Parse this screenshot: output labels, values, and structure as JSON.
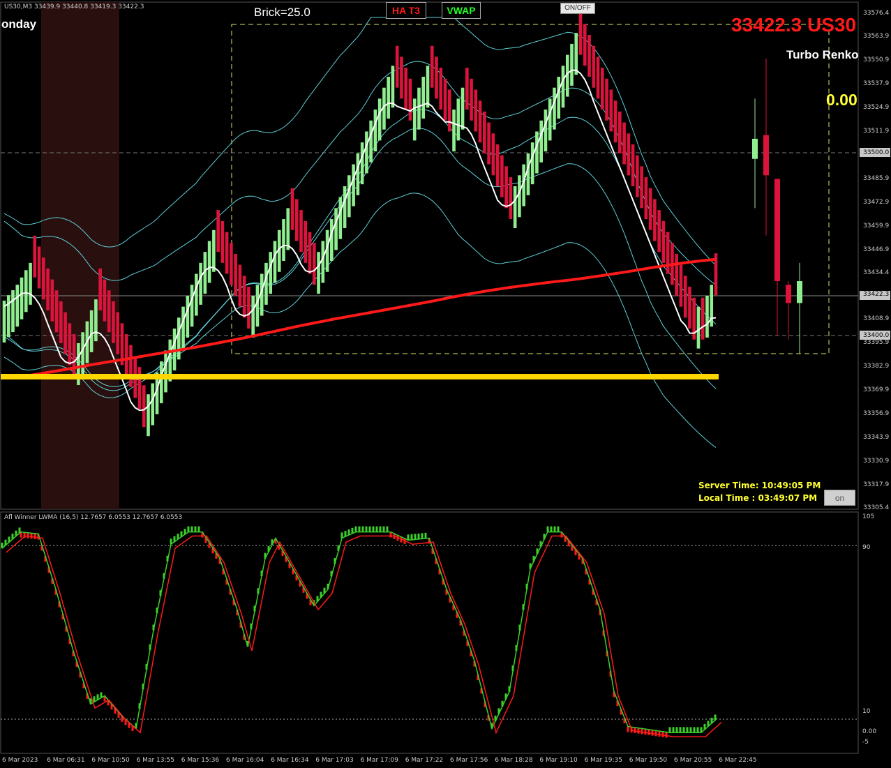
{
  "symbol_info": "US30,M3  33439.9 33440.8 33419.3 33422.3",
  "day_label": "onday",
  "brick_label": "Brick=25.0",
  "buttons": {
    "ha_t3": "HA T3",
    "vwap": "VWAP",
    "on_off": "ON/OFF",
    "on": "on"
  },
  "price_display": "33422.3 US30",
  "chart_type_label": "Turbo Renko",
  "value_display": "0.00",
  "server_time": "Server Time: 10:49:05 PM",
  "local_time": "Local Time  : 03:49:07 PM",
  "indicator_label": "Afl Winner LWMA (16,5) 12.7657 6.0553 12.7657 6.0553",
  "price_axis": [
    "33576.4",
    "33563.9",
    "33550.9",
    "33537.9",
    "33524.9",
    "33511.9",
    "33500.0",
    "33485.9",
    "33472.9",
    "33459.9",
    "33446.9",
    "33434.4",
    "33422.3",
    "33408.9",
    "33400.0",
    "33395.9",
    "33382.9",
    "33369.9",
    "33356.9",
    "33343.9",
    "33330.9",
    "33317.9",
    "33305.4"
  ],
  "indicator_axis": [
    "105",
    "90",
    "10",
    "0.00",
    "-5"
  ],
  "time_axis": [
    "6 Mar 2023",
    "6 Mar 06:31",
    "6 Mar 10:50",
    "6 Mar 13:55",
    "6 Mar 15:36",
    "6 Mar 16:04",
    "6 Mar 16:34",
    "6 Mar 17:03",
    "6 Mar 17:09",
    "6 Mar 17:22",
    "6 Mar 17:56",
    "6 Mar 18:28",
    "6 Mar 19:10",
    "6 Mar 19:35",
    "6 Mar 19:50",
    "6 Mar 20:55",
    "6 Mar 22:45"
  ],
  "colors": {
    "bull": "#90ee90",
    "bear": "#dc143c",
    "band": "#5fcfd8",
    "red_line": "#ff1a1a",
    "yellow_line": "#ffd700",
    "osc_green": "#3ccf2a",
    "osc_red": "#ff1a1a"
  },
  "chart_data": {
    "type": "candlestick",
    "bricks": [
      {
        "p": 33419.3,
        "d": 1
      },
      {
        "p": 33422.3,
        "d": 1
      },
      {
        "p": 33425,
        "d": 1
      },
      {
        "p": 33428,
        "d": 1
      },
      {
        "p": 33432,
        "d": 1
      },
      {
        "p": 33436,
        "d": 1
      },
      {
        "p": 33440,
        "d": 1
      },
      {
        "p": 33432,
        "d": -1
      },
      {
        "p": 33426,
        "d": -1
      },
      {
        "p": 33420,
        "d": -1
      },
      {
        "p": 33414,
        "d": -1
      },
      {
        "p": 33408,
        "d": -1
      },
      {
        "p": 33402,
        "d": -1
      },
      {
        "p": 33396,
        "d": -1
      },
      {
        "p": 33390,
        "d": -1
      },
      {
        "p": 33384,
        "d": -1
      },
      {
        "p": 33378,
        "d": -1
      },
      {
        "p": 33396,
        "d": 1
      },
      {
        "p": 33402,
        "d": 1
      },
      {
        "p": 33408,
        "d": 1
      },
      {
        "p": 33414,
        "d": 1
      },
      {
        "p": 33420,
        "d": 1
      },
      {
        "p": 33414,
        "d": -1
      },
      {
        "p": 33408,
        "d": -1
      },
      {
        "p": 33402,
        "d": -1
      },
      {
        "p": 33396,
        "d": -1
      },
      {
        "p": 33390,
        "d": -1
      },
      {
        "p": 33384,
        "d": -1
      },
      {
        "p": 33378,
        "d": -1
      },
      {
        "p": 33372,
        "d": -1
      },
      {
        "p": 33366,
        "d": -1
      },
      {
        "p": 33360,
        "d": -1
      },
      {
        "p": 33350,
        "d": -1
      },
      {
        "p": 33368,
        "d": 1
      },
      {
        "p": 33374,
        "d": 1
      },
      {
        "p": 33380,
        "d": 1
      },
      {
        "p": 33386,
        "d": 1
      },
      {
        "p": 33392,
        "d": 1
      },
      {
        "p": 33398,
        "d": 1
      },
      {
        "p": 33404,
        "d": 1
      },
      {
        "p": 33410,
        "d": 1
      },
      {
        "p": 33416,
        "d": 1
      },
      {
        "p": 33422,
        "d": 1
      },
      {
        "p": 33428,
        "d": 1
      },
      {
        "p": 33434,
        "d": 1
      },
      {
        "p": 33440,
        "d": 1
      },
      {
        "p": 33446,
        "d": 1
      },
      {
        "p": 33452,
        "d": 1
      },
      {
        "p": 33458,
        "d": 1
      },
      {
        "p": 33446,
        "d": -1
      },
      {
        "p": 33440,
        "d": -1
      },
      {
        "p": 33434,
        "d": -1
      },
      {
        "p": 33428,
        "d": -1
      },
      {
        "p": 33422,
        "d": -1
      },
      {
        "p": 33416,
        "d": -1
      },
      {
        "p": 33410,
        "d": -1
      },
      {
        "p": 33404,
        "d": -1
      },
      {
        "p": 33422,
        "d": 1
      },
      {
        "p": 33428,
        "d": 1
      },
      {
        "p": 33434,
        "d": 1
      },
      {
        "p": 33440,
        "d": 1
      },
      {
        "p": 33446,
        "d": 1
      },
      {
        "p": 33452,
        "d": 1
      },
      {
        "p": 33458,
        "d": 1
      },
      {
        "p": 33464,
        "d": 1
      },
      {
        "p": 33470,
        "d": 1
      },
      {
        "p": 33458,
        "d": -1
      },
      {
        "p": 33452,
        "d": -1
      },
      {
        "p": 33446,
        "d": -1
      },
      {
        "p": 33440,
        "d": -1
      },
      {
        "p": 33434,
        "d": -1
      },
      {
        "p": 33428,
        "d": -1
      },
      {
        "p": 33446,
        "d": 1
      },
      {
        "p": 33452,
        "d": 1
      },
      {
        "p": 33458,
        "d": 1
      },
      {
        "p": 33464,
        "d": 1
      },
      {
        "p": 33470,
        "d": 1
      },
      {
        "p": 33476,
        "d": 1
      },
      {
        "p": 33482,
        "d": 1
      },
      {
        "p": 33488,
        "d": 1
      },
      {
        "p": 33494,
        "d": 1
      },
      {
        "p": 33500,
        "d": 1
      },
      {
        "p": 33506,
        "d": 1
      },
      {
        "p": 33512,
        "d": 1
      },
      {
        "p": 33518,
        "d": 1
      },
      {
        "p": 33524,
        "d": 1
      },
      {
        "p": 33530,
        "d": 1
      },
      {
        "p": 33536,
        "d": 1
      },
      {
        "p": 33542,
        "d": 1
      },
      {
        "p": 33548,
        "d": 1
      },
      {
        "p": 33536,
        "d": -1
      },
      {
        "p": 33530,
        "d": -1
      },
      {
        "p": 33524,
        "d": -1
      },
      {
        "p": 33518,
        "d": -1
      },
      {
        "p": 33530,
        "d": 1
      },
      {
        "p": 33536,
        "d": 1
      },
      {
        "p": 33542,
        "d": 1
      },
      {
        "p": 33548,
        "d": 1
      },
      {
        "p": 33536,
        "d": -1
      },
      {
        "p": 33530,
        "d": -1
      },
      {
        "p": 33524,
        "d": -1
      },
      {
        "p": 33518,
        "d": -1
      },
      {
        "p": 33512,
        "d": -1
      },
      {
        "p": 33524,
        "d": 1
      },
      {
        "p": 33530,
        "d": 1
      },
      {
        "p": 33536,
        "d": 1
      },
      {
        "p": 33524,
        "d": -1
      },
      {
        "p": 33518,
        "d": -1
      },
      {
        "p": 33512,
        "d": -1
      },
      {
        "p": 33506,
        "d": -1
      },
      {
        "p": 33500,
        "d": -1
      },
      {
        "p": 33494,
        "d": -1
      },
      {
        "p": 33488,
        "d": -1
      },
      {
        "p": 33482,
        "d": -1
      },
      {
        "p": 33476,
        "d": -1
      },
      {
        "p": 33470,
        "d": -1
      },
      {
        "p": 33464,
        "d": -1
      },
      {
        "p": 33482,
        "d": 1
      },
      {
        "p": 33488,
        "d": 1
      },
      {
        "p": 33494,
        "d": 1
      },
      {
        "p": 33500,
        "d": 1
      },
      {
        "p": 33506,
        "d": 1
      },
      {
        "p": 33512,
        "d": 1
      },
      {
        "p": 33518,
        "d": 1
      },
      {
        "p": 33524,
        "d": 1
      },
      {
        "p": 33530,
        "d": 1
      },
      {
        "p": 33536,
        "d": 1
      },
      {
        "p": 33542,
        "d": 1
      },
      {
        "p": 33548,
        "d": 1
      },
      {
        "p": 33554,
        "d": 1
      },
      {
        "p": 33560,
        "d": 1
      },
      {
        "p": 33566,
        "d": 1
      },
      {
        "p": 33554,
        "d": -1
      },
      {
        "p": 33548,
        "d": -1
      },
      {
        "p": 33542,
        "d": -1
      },
      {
        "p": 33536,
        "d": -1
      },
      {
        "p": 33530,
        "d": -1
      },
      {
        "p": 33524,
        "d": -1
      },
      {
        "p": 33518,
        "d": -1
      },
      {
        "p": 33512,
        "d": -1
      },
      {
        "p": 33506,
        "d": -1
      },
      {
        "p": 33500,
        "d": -1
      },
      {
        "p": 33494,
        "d": -1
      },
      {
        "p": 33488,
        "d": -1
      },
      {
        "p": 33482,
        "d": -1
      },
      {
        "p": 33476,
        "d": -1
      },
      {
        "p": 33470,
        "d": -1
      },
      {
        "p": 33464,
        "d": -1
      },
      {
        "p": 33458,
        "d": -1
      },
      {
        "p": 33452,
        "d": -1
      },
      {
        "p": 33446,
        "d": -1
      },
      {
        "p": 33440,
        "d": -1
      },
      {
        "p": 33434,
        "d": -1
      },
      {
        "p": 33428,
        "d": -1
      },
      {
        "p": 33422,
        "d": -1
      },
      {
        "p": 33416,
        "d": -1
      },
      {
        "p": 33410,
        "d": -1
      },
      {
        "p": 33404,
        "d": -1
      },
      {
        "p": 33398,
        "d": -1
      },
      {
        "p": 33416,
        "d": 1
      },
      {
        "p": 33398,
        "d": -1
      },
      {
        "p": 33422,
        "d": 1
      },
      {
        "p": 33428,
        "d": 1
      },
      {
        "p": 33422.3,
        "d": -1
      }
    ],
    "htf_candles": [
      {
        "o": 33497,
        "c": 33508,
        "h": 33530,
        "l": 33470,
        "d": 1
      },
      {
        "o": 33510,
        "c": 33488,
        "h": 33552,
        "l": 33455,
        "d": -1
      },
      {
        "o": 33486,
        "c": 33430,
        "h": 33486,
        "l": 33400,
        "d": -1
      },
      {
        "o": 33428,
        "c": 33418,
        "h": 33430,
        "l": 33398,
        "d": -1
      },
      {
        "o": 33418,
        "c": 33430,
        "h": 33440,
        "l": 33390,
        "d": 1
      }
    ],
    "price_range": [
      33305.4,
      33576.4
    ],
    "indicator_range": [
      -5,
      105
    ],
    "indicator_levels": [
      90,
      10
    ]
  }
}
